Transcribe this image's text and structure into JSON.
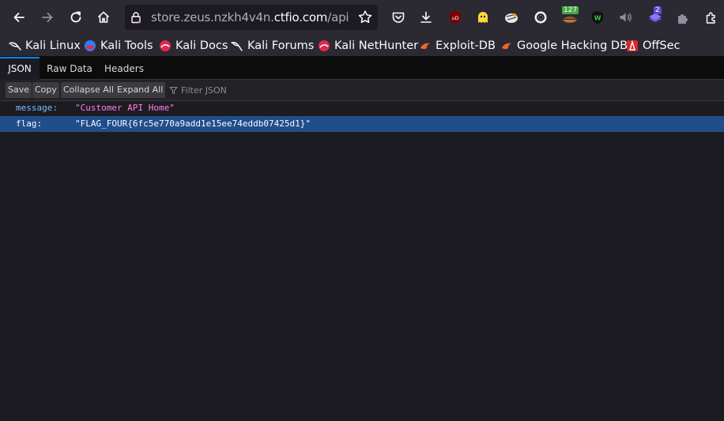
{
  "browser": {
    "url_prefix": "store.zeus.",
    "url_host": "nzkh4v4n.",
    "url_domain": "ctfio.com",
    "url_path": "/api",
    "extensions": [
      {
        "name": "ublock-origin",
        "badge": ""
      },
      {
        "name": "ghost-extension",
        "badge": ""
      },
      {
        "name": "hackbar",
        "badge": ""
      },
      {
        "name": "proxy-icon",
        "badge": ""
      },
      {
        "name": "wappalyzer",
        "badge": "127"
      },
      {
        "name": "w-extension",
        "badge": ""
      },
      {
        "name": "sound-icon",
        "badge": ""
      },
      {
        "name": "stack-extension",
        "badge": "2"
      },
      {
        "name": "puzzle-icon",
        "badge": ""
      }
    ]
  },
  "bookmarks": [
    {
      "label": "Kali Linux",
      "icon": "kali-dragon-icon"
    },
    {
      "label": "Kali Tools",
      "icon": "kali-tools-icon"
    },
    {
      "label": "Kali Docs",
      "icon": "kali-docs-icon"
    },
    {
      "label": "Kali Forums",
      "icon": "kali-forums-icon"
    },
    {
      "label": "Kali NetHunter",
      "icon": "kali-nethunter-icon"
    },
    {
      "label": "Exploit-DB",
      "icon": "exploit-db-icon"
    },
    {
      "label": "Google Hacking DB",
      "icon": "ghdb-icon"
    },
    {
      "label": "OffSec",
      "icon": "offsec-icon"
    }
  ],
  "viewer": {
    "tabs": [
      "JSON",
      "Raw Data",
      "Headers"
    ],
    "buttons": {
      "save": "Save",
      "copy": "Copy",
      "collapse_all": "Collapse All",
      "expand_all": "Expand All"
    },
    "filter_placeholder": "Filter JSON",
    "rows": [
      {
        "key": "message:",
        "value": "\"Customer API Home\""
      },
      {
        "key": "flag:",
        "value": "\"FLAG_FOUR{6fc5e770a9add1e15ee74eddb07425d1}\""
      }
    ]
  },
  "colors": {
    "accent": "#0a84ff",
    "selected_row": "#204e8a",
    "json_key": "#75bfff",
    "json_string": "#ff7de9"
  }
}
